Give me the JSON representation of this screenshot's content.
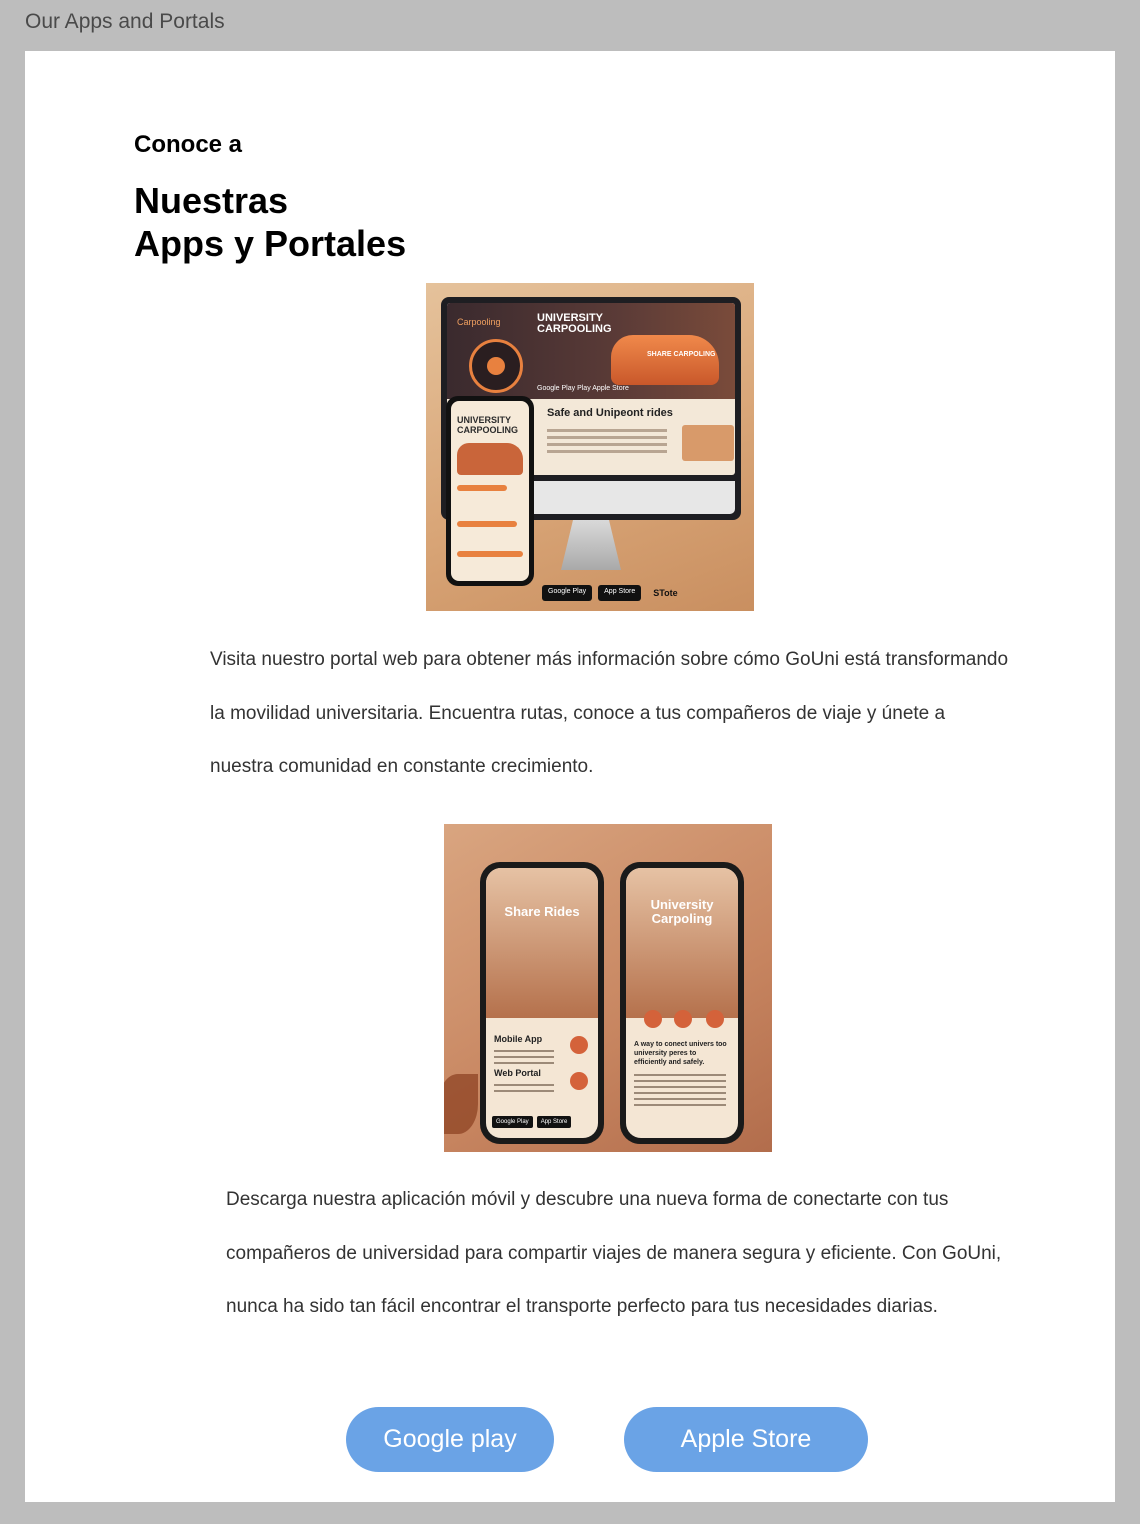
{
  "window": {
    "title": "Our Apps and Portals"
  },
  "section": {
    "eyebrow": "Conoce a",
    "headline_line1": "Nuestras",
    "headline_line2": "Apps y Portales"
  },
  "image1": {
    "brand": "Carpooling",
    "title_line1": "UNIVERSITY",
    "title_line2": "CARPOOLING",
    "car_label": "SHARE CARPOLING",
    "stores": "Google Play   Play   Apple Store",
    "subtitle": "Safe and Unipeont rides",
    "phone_title_line1": "UNIVERSITY",
    "phone_title_line2": "CARPOOLING",
    "badge_google": "Google Play",
    "badge_appstore": "App Store",
    "badge_stote": "STote"
  },
  "paragraph1": "Visita nuestro portal web para obtener más información sobre cómo GoUni está transformando la movilidad universitaria. Encuentra rutas, conoce a tus compañeros de viaje y únete a nuestra comunidad en constante crecimiento.",
  "image2": {
    "left_title": "Share Rides",
    "left_mobile": "Mobile App",
    "left_web": "Web Portal",
    "left_google": "Google Play",
    "left_webportal": "Web Portal",
    "right_title_line1": "University",
    "right_title_line2": "Carpoling",
    "right_tagline": "A way to conect univers too university peres to efficiently and safely.",
    "badge_google": "Google Play",
    "badge_appstore": "App Store"
  },
  "paragraph2": "Descarga nuestra aplicación móvil y descubre una nueva forma de conectarte con tus compañeros de universidad para compartir viajes de manera segura y eficiente. Con GoUni, nunca ha sido tan fácil encontrar el transporte perfecto para tus necesidades diarias.",
  "buttons": {
    "google": "Google play",
    "apple": "Apple Store"
  },
  "colors": {
    "button": "#6aa3e6",
    "background": "#bdbdbd",
    "card": "#ffffff",
    "accent_orange": "#e8813f"
  }
}
